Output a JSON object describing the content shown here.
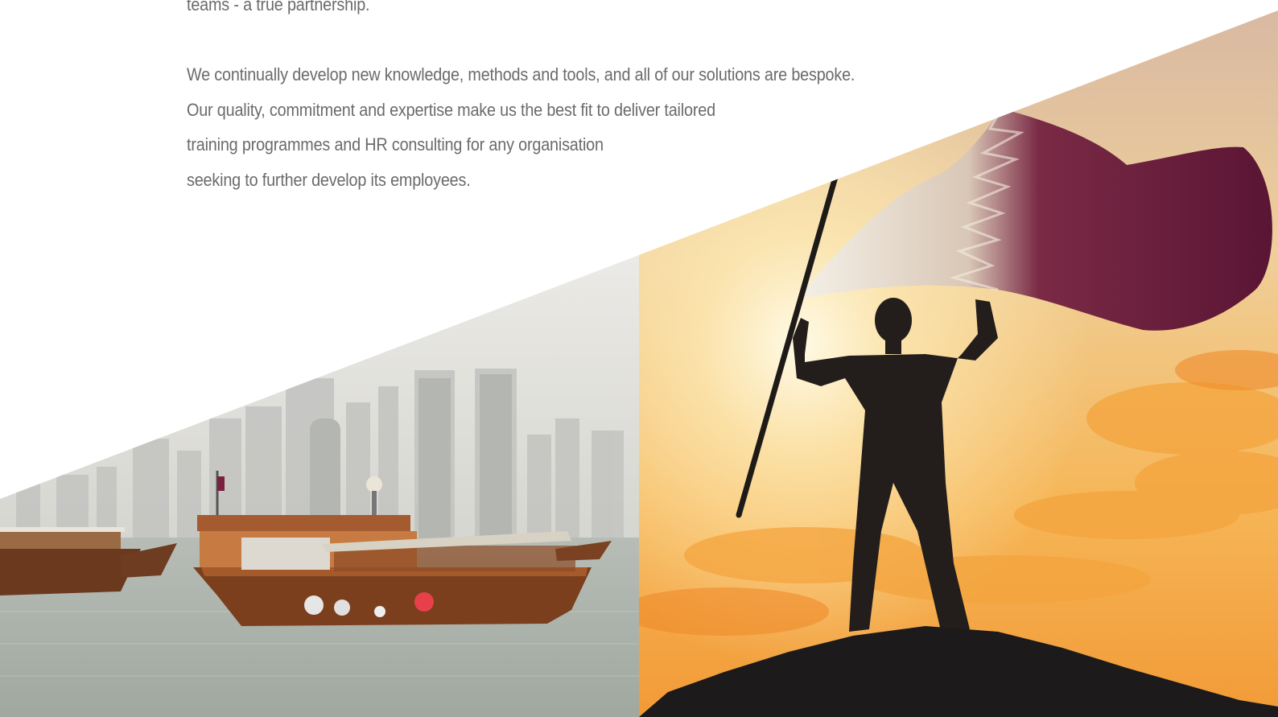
{
  "intro": {
    "line_0": "teams - a true partnership.",
    "line_1": "We continually develop new knowledge, methods and tools, and all of our solutions are bespoke.",
    "line_2": "Our quality, commitment and expertise make us the best fit to deliver tailored",
    "line_3": "training programmes and HR consulting for any organisation",
    "line_4": "seeking to further develop its employees."
  },
  "images": {
    "left": "doha-dhow-boats-skyline-photo",
    "right": "man-raising-qatar-flag-sunset-photo"
  },
  "colors": {
    "body_text": "#6b6b6b",
    "flag_maroon": "#6e1a3c",
    "sunset": "#f4b04a",
    "haze": "#d9d9d4"
  }
}
